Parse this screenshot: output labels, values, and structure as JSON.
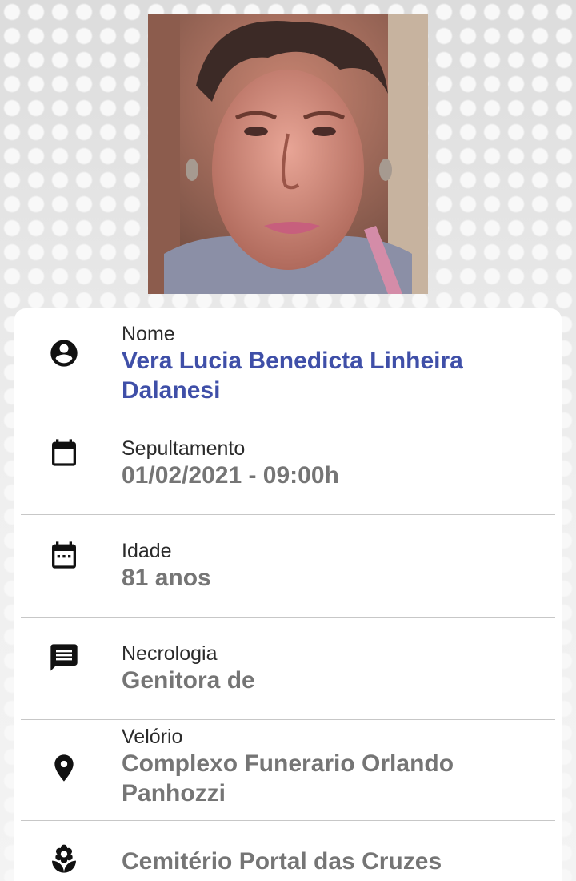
{
  "photo": {
    "alt_icon": "deceased-portrait"
  },
  "fields": [
    {
      "icon": "account-circle-icon",
      "label": "Nome",
      "value": "Vera Lucia Benedicta Linheira Dalanesi"
    },
    {
      "icon": "calendar-icon",
      "label": "Sepultamento",
      "value": "01/02/2021 - 09:00h"
    },
    {
      "icon": "calendar-event-icon",
      "label": "Idade",
      "value": "81 anos"
    },
    {
      "icon": "message-icon",
      "label": "Necrologia",
      "value": "Genitora de"
    },
    {
      "icon": "location-pin-icon",
      "label": "Velório",
      "value": "Complexo Funerario Orlando Panhozzi"
    },
    {
      "icon": "flower-icon",
      "label": "",
      "value": "Cemitério Portal das Cruzes"
    }
  ],
  "colors": {
    "name": "#3f4fa8",
    "value": "#757575",
    "label": "#2b2b2b"
  }
}
